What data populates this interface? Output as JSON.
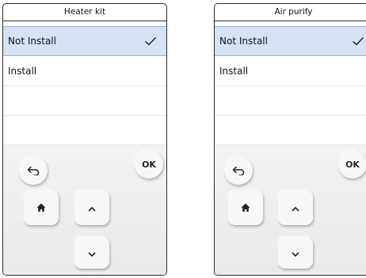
{
  "panels": [
    {
      "title": "Heater kit",
      "options": [
        {
          "label": "Not Install",
          "selected": true
        },
        {
          "label": "Install",
          "selected": false
        }
      ],
      "ok_label": "OK"
    },
    {
      "title": "Air purify",
      "options": [
        {
          "label": "Not Install",
          "selected": true
        },
        {
          "label": "Install",
          "selected": false
        }
      ],
      "ok_label": "OK"
    }
  ],
  "icons": {
    "check": "check-icon",
    "back": "back-arrow-icon",
    "home": "home-icon",
    "up": "chevron-up-icon",
    "down": "chevron-down-icon"
  },
  "colors": {
    "selected_row": "#d6e1f1",
    "border": "#2b2b2b",
    "control_bg": "#efefef"
  }
}
